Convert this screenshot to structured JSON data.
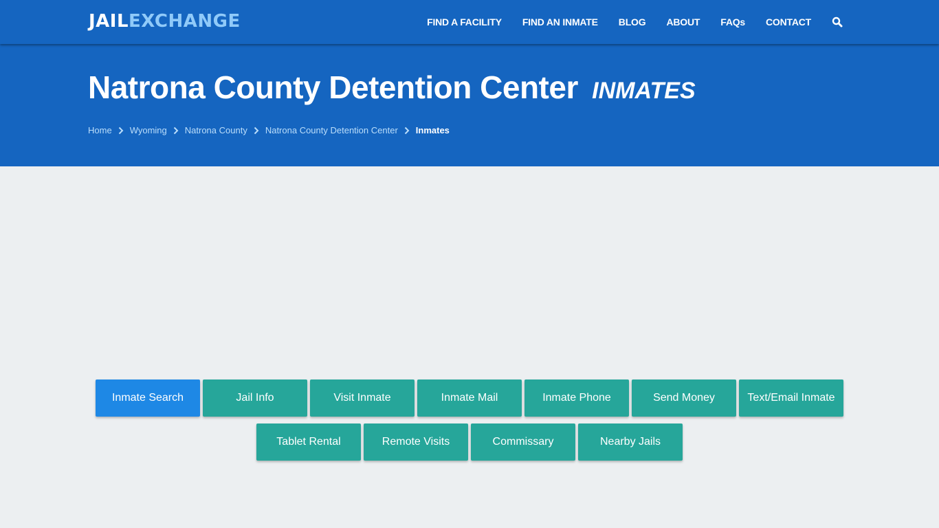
{
  "header": {
    "logo_part1": "JAIL",
    "logo_part2": "EXCHANGE",
    "nav": [
      {
        "label": "FIND A FACILITY"
      },
      {
        "label": "FIND AN INMATE"
      },
      {
        "label": "BLOG"
      },
      {
        "label": "ABOUT"
      },
      {
        "label": "FAQs"
      },
      {
        "label": "CONTACT"
      }
    ],
    "search_icon": "search-icon"
  },
  "hero": {
    "title": "Natrona County Detention Center",
    "subtitle": "INMATES",
    "breadcrumb": [
      {
        "label": "Home"
      },
      {
        "label": "Wyoming"
      },
      {
        "label": "Natrona County"
      },
      {
        "label": "Natrona County Detention Center"
      },
      {
        "label": "Inmates"
      }
    ]
  },
  "buttons": [
    {
      "label": "Inmate Search",
      "active": true
    },
    {
      "label": "Jail Info"
    },
    {
      "label": "Visit Inmate"
    },
    {
      "label": "Inmate Mail"
    },
    {
      "label": "Inmate Phone"
    },
    {
      "label": "Send Money"
    },
    {
      "label": "Text/Email Inmate"
    },
    {
      "label": "Tablet Rental"
    },
    {
      "label": "Remote Visits"
    },
    {
      "label": "Commissary"
    },
    {
      "label": "Nearby Jails"
    }
  ],
  "colors": {
    "brand_blue": "#1565c0",
    "logo_accent": "#90caf9",
    "button_teal": "#26a69a",
    "button_active": "#1e88e5",
    "page_bg": "#eceff1"
  }
}
